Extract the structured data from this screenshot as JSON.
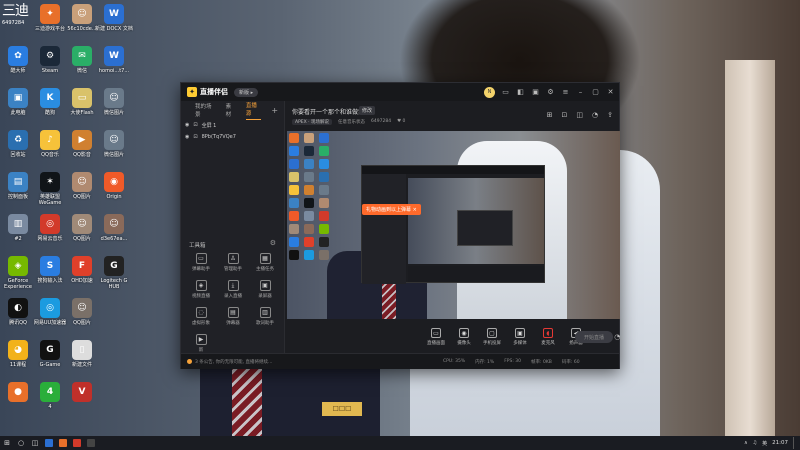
{
  "desktop": {
    "clock_widget": {
      "time": "三迪",
      "sub": "6497284"
    },
    "icons": [
      {
        "id": "d1",
        "label": "三迪游戏平台",
        "color": "#e8702a",
        "glyph": "✦"
      },
      {
        "id": "d2",
        "label": "56c10cde...",
        "color": "#c9a07a",
        "glyph": "☺"
      },
      {
        "id": "d3",
        "label": "新建 DOCX 文档",
        "color": "#2b6fd1",
        "glyph": "W"
      },
      {
        "id": "d4",
        "label": "酷大师",
        "color": "#2a7de1",
        "glyph": "✿"
      },
      {
        "id": "d5",
        "label": "Steam",
        "color": "#1b2838",
        "glyph": "⚙"
      },
      {
        "id": "d6",
        "label": "微信",
        "color": "#2aae67",
        "glyph": "✉"
      },
      {
        "id": "d7",
        "label": "homoi...t7...",
        "color": "#2b6fd1",
        "glyph": "W"
      },
      {
        "id": "d8",
        "label": "此电脑",
        "color": "#3b82c4",
        "glyph": "▣"
      },
      {
        "id": "d9",
        "label": "酷狗",
        "color": "#2a8de1",
        "glyph": "K"
      },
      {
        "id": "d10",
        "label": "大使Flash",
        "color": "#d9c26a",
        "glyph": "▭"
      },
      {
        "id": "d11",
        "label": "微信图片",
        "color": "#6a7a8a",
        "glyph": "☺"
      },
      {
        "id": "d12",
        "label": "回收站",
        "color": "#2a6fb0",
        "glyph": "♻"
      },
      {
        "id": "d13",
        "label": "QQ音乐",
        "color": "#f6c23a",
        "glyph": "♪"
      },
      {
        "id": "d14",
        "label": "QQ影音",
        "color": "#d08030",
        "glyph": "▶"
      },
      {
        "id": "d15",
        "label": "微信图片",
        "color": "#6a7a8a",
        "glyph": "☺"
      },
      {
        "id": "d16",
        "label": "控制面板",
        "color": "#3b82c4",
        "glyph": "▤"
      },
      {
        "id": "d17",
        "label": "英雄联盟WeGame",
        "color": "#101418",
        "glyph": "✶"
      },
      {
        "id": "d18",
        "label": "QQ图片",
        "color": "#b08a70",
        "glyph": "☺"
      },
      {
        "id": "d19",
        "label": "Origin",
        "color": "#f05a28",
        "glyph": "◉"
      },
      {
        "id": "d20",
        "label": "#2",
        "color": "#7a8aa0",
        "glyph": "▥"
      },
      {
        "id": "d21",
        "label": "网易云音乐",
        "color": "#d23a2a",
        "glyph": "◎"
      },
      {
        "id": "d22",
        "label": "QQ图片",
        "color": "#a08a78",
        "glyph": "☺"
      },
      {
        "id": "d23",
        "label": "d3e67ea...",
        "color": "#8a6a5a",
        "glyph": "☺"
      },
      {
        "id": "d24",
        "label": "GeForce Experience",
        "color": "#76b900",
        "glyph": "◈"
      },
      {
        "id": "d25",
        "label": "搜狗输入法",
        "color": "#2a7de1",
        "glyph": "S"
      },
      {
        "id": "d26",
        "label": "OHD加速",
        "color": "#e0402a",
        "glyph": "F"
      },
      {
        "id": "d27",
        "label": "Logitech G HUB",
        "color": "#222",
        "glyph": "G"
      },
      {
        "id": "d28",
        "label": "腾讯QQ",
        "color": "#111",
        "glyph": "◐"
      },
      {
        "id": "d29",
        "label": "网易UU加速器",
        "color": "#1b9be0",
        "glyph": "◎"
      },
      {
        "id": "d30",
        "label": "QQ图片",
        "color": "#7a7068",
        "glyph": "☺"
      },
      {
        "id": "d31",
        "label": "11课程",
        "color": "#f2b21a",
        "glyph": "◕"
      },
      {
        "id": "d32",
        "label": "G-Game",
        "color": "#111",
        "glyph": "G"
      },
      {
        "id": "d33",
        "label": "新建文件",
        "color": "#ddd",
        "glyph": "▯"
      },
      {
        "id": "d34",
        "label": "",
        "color": "#e8702a",
        "glyph": "●"
      },
      {
        "id": "d35",
        "label": "4",
        "color": "#2aae3a",
        "glyph": "4"
      },
      {
        "id": "d36",
        "label": "",
        "color": "#c0302a",
        "glyph": "V"
      }
    ]
  },
  "app": {
    "name": "直播伴侣",
    "version_pill": "新版 ▸",
    "avatar_text": "N",
    "left_panel": {
      "tabs": [
        "我的场景",
        "素材",
        "直播源"
      ],
      "active_tab": 2,
      "add_label": "+",
      "scenes": [
        {
          "name": "全屏 1"
        },
        {
          "name": "8Pb(Tq7VQe7"
        }
      ],
      "toolbox_title": "工具箱",
      "tools": [
        {
          "icon": "▭",
          "label": "弹幕助手"
        },
        {
          "icon": "♙",
          "label": "管理助手"
        },
        {
          "icon": "▦",
          "label": "主播任务"
        },
        {
          "icon": "◈",
          "label": "视频直播"
        },
        {
          "icon": "⤓",
          "label": "录入直播"
        },
        {
          "icon": "▣",
          "label": "录屏器"
        },
        {
          "icon": "◌",
          "label": "虚拟形象"
        },
        {
          "icon": "▤",
          "label": "弹幕器"
        },
        {
          "icon": "▥",
          "label": "歌词助手"
        },
        {
          "icon": "▶",
          "label": "新"
        }
      ]
    },
    "main": {
      "room_title": "你要看开一个那个和谁做第",
      "edit_label": "修改",
      "category": "APEX · 现场解说",
      "sub_items": [
        "任意音乐状态",
        "6497284",
        "♥ 0"
      ],
      "preview_toast": "礼物动画到以上弹幕 ×",
      "actions": [
        {
          "icon": "▭",
          "label": "直播画面"
        },
        {
          "icon": "◉",
          "label": "摄像头"
        },
        {
          "icon": "▢",
          "label": "手机投屏"
        },
        {
          "icon": "▣",
          "label": "多媒体"
        },
        {
          "icon": "◖",
          "label": "麦克风",
          "accent": true
        },
        {
          "icon": "◀",
          "label": "扬声器"
        }
      ],
      "go_live": "开始直播"
    },
    "status": {
      "message": "3 条公告, 你的无限可能, 直播将继续...",
      "stats": [
        "CPU: 35%",
        "内存: 1%",
        "FPS: 30",
        "帧率: 0KB",
        "码率: 60"
      ]
    }
  },
  "taskbar": {
    "time": "21:07",
    "tray": [
      "∧",
      "♫",
      "英"
    ]
  }
}
